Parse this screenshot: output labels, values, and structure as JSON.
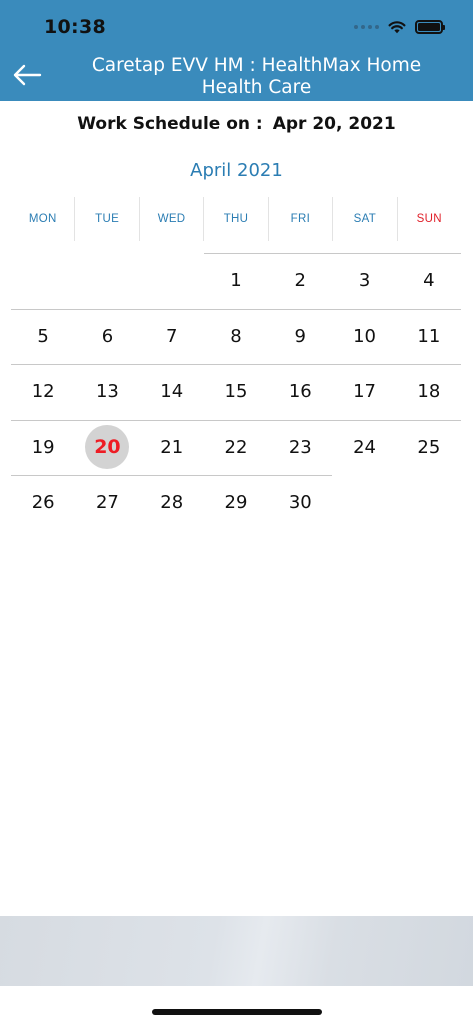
{
  "status_bar": {
    "time": "10:38"
  },
  "header": {
    "title": "Caretap EVV HM : HealthMax Home Health Care"
  },
  "schedule": {
    "label": "Work Schedule on :",
    "date": "Apr 20, 2021"
  },
  "calendar": {
    "month_title": "April 2021",
    "weekdays": [
      "MON",
      "TUE",
      "WED",
      "THU",
      "FRI",
      "SAT",
      "SUN"
    ],
    "selected_day": "20",
    "weeks": [
      [
        "",
        "",
        "",
        "1",
        "2",
        "3",
        "4"
      ],
      [
        "5",
        "6",
        "7",
        "8",
        "9",
        "10",
        "11"
      ],
      [
        "12",
        "13",
        "14",
        "15",
        "16",
        "17",
        "18"
      ],
      [
        "19",
        "20",
        "21",
        "22",
        "23",
        "24",
        "25"
      ],
      [
        "26",
        "27",
        "28",
        "29",
        "30",
        "",
        ""
      ]
    ]
  },
  "colors": {
    "header_bg": "#3a8bbc",
    "accent_blue": "#2b7db3",
    "sunday_red": "#e0202a",
    "selected_day_text": "#ee1c24",
    "selected_day_bg": "#d3d3d3"
  },
  "icons": {
    "back": "arrow-left-icon",
    "wifi": "wifi-icon",
    "battery": "battery-icon",
    "signal": "cellular-signal-icon"
  }
}
